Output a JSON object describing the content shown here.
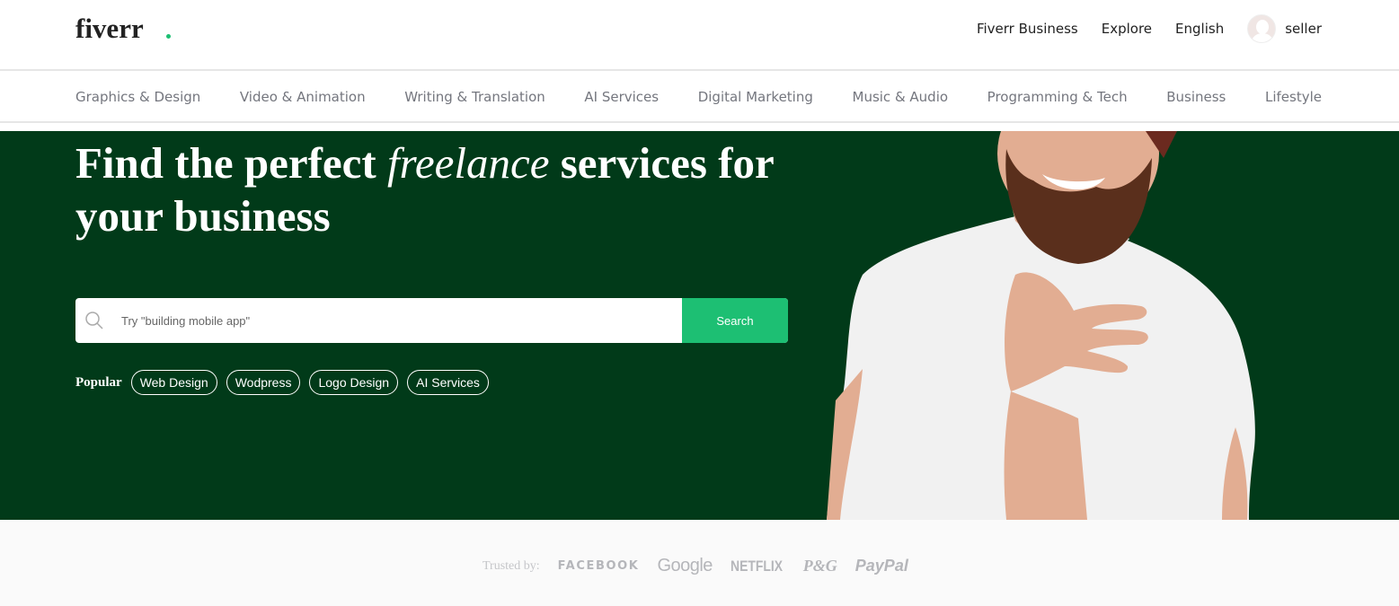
{
  "header": {
    "logo": "fiverr",
    "nav": {
      "business": "Fiverr Business",
      "explore": "Explore",
      "language": "English",
      "user": "seller"
    }
  },
  "categories": [
    "Graphics & Design",
    "Video & Animation",
    "Writing & Translation",
    "AI Services",
    "Digital Marketing",
    "Music & Audio",
    "Programming & Tech",
    "Business",
    "Lifestyle"
  ],
  "hero": {
    "headline_pre": "Find the perfect ",
    "headline_em": "freelance",
    "headline_post": " services for your business",
    "search_placeholder": "Try \"building mobile app\"",
    "search_button": "Search",
    "popular_label": "Popular",
    "popular_tags": [
      "Web Design",
      "Wodpress",
      "Logo Design",
      "AI Services"
    ]
  },
  "trusted": {
    "label": "Trusted by:",
    "brands": [
      "FACEBOOK",
      "Google",
      "NETFLIX",
      "P&G",
      "PayPal"
    ]
  },
  "colors": {
    "hero_bg": "#013a19",
    "accent": "#1dbf73",
    "category_text": "#74767e"
  },
  "icons": {
    "search": "search-icon",
    "avatar": "user-avatar-icon"
  }
}
